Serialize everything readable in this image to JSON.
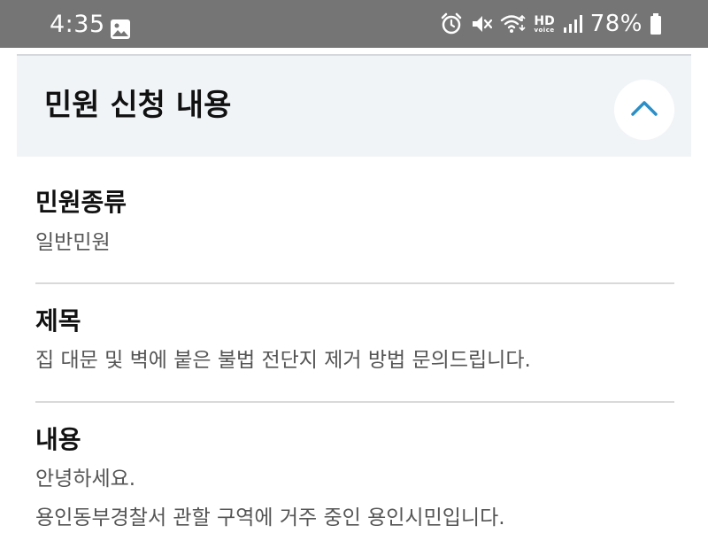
{
  "status_bar": {
    "time": "4:35",
    "hd_label": "HD",
    "voice_label": "voice",
    "battery": "78%",
    "icons": [
      "gallery-icon",
      "alarm-icon",
      "mute-icon",
      "wifi-icon",
      "hd-voice-icon",
      "signal-icon",
      "battery-icon"
    ]
  },
  "section": {
    "title": "민원 신청 내용",
    "toggle_icon": "chevron-up-icon",
    "accent_color": "#2a8fc7"
  },
  "fields": {
    "type": {
      "label": "민원종류",
      "value": "일반민원"
    },
    "subject": {
      "label": "제목",
      "value": "집 대문 및 벽에 붙은 불법 전단지 제거 방법 문의드립니다."
    },
    "content": {
      "label": "내용",
      "lines": [
        "안녕하세요.",
        "용인동부경찰서 관할 구역에 거주 중인 용인시민입니다."
      ]
    }
  }
}
